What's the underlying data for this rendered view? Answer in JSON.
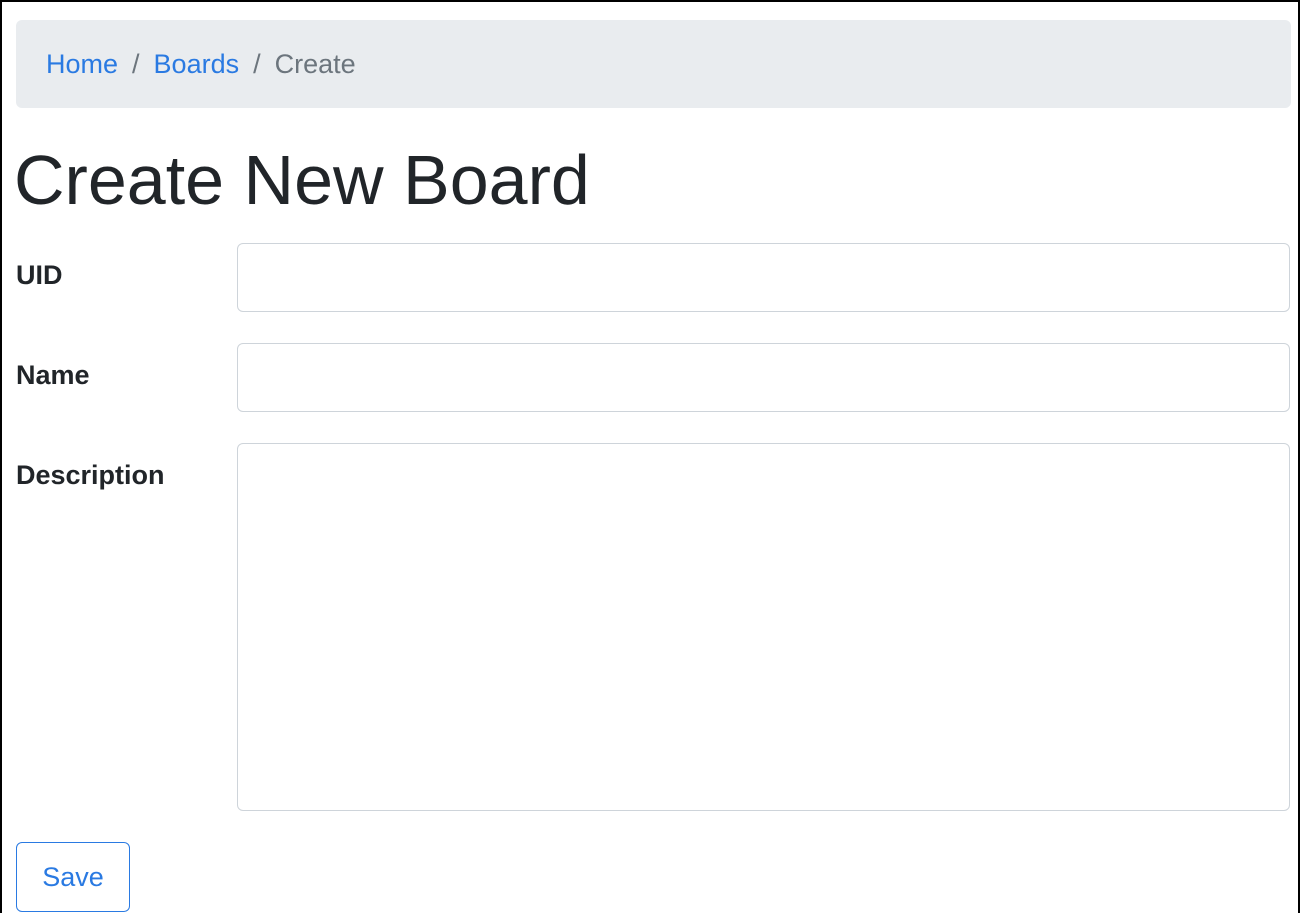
{
  "breadcrumb": {
    "items": [
      {
        "label": "Home"
      },
      {
        "label": "Boards"
      },
      {
        "label": "Create"
      }
    ],
    "separator": "/"
  },
  "page": {
    "title": "Create New Board"
  },
  "form": {
    "uid": {
      "label": "UID",
      "value": ""
    },
    "name": {
      "label": "Name",
      "value": ""
    },
    "description": {
      "label": "Description",
      "value": ""
    },
    "save_label": "Save"
  },
  "colors": {
    "link": "#2a7ae2",
    "breadcrumb_bg": "#e9ecef",
    "muted": "#6c757d",
    "text": "#212529",
    "input_border": "#ced4da"
  }
}
